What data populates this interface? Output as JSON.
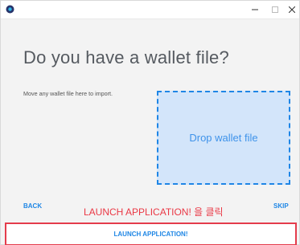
{
  "titlebar": {
    "app_icon": "app-logo-icon",
    "minimize_icon": "minimize-icon",
    "maximize_icon": "maximize-icon",
    "close_icon": "close-icon"
  },
  "main": {
    "heading": "Do you have a wallet file?",
    "subtext": "Move any wallet file here to import.",
    "dropzone_label": "Drop wallet file"
  },
  "nav": {
    "back_label": "BACK",
    "skip_label": "SKIP"
  },
  "annotation": {
    "text": "LAUNCH APPLICATION! 을 클릭",
    "color": "#ea3845"
  },
  "footer": {
    "launch_label": "LAUNCH APPLICATION!"
  },
  "colors": {
    "accent": "#1e86e5",
    "dropzone_bg": "#d3e5fa",
    "highlight_border": "#e43c4c"
  }
}
